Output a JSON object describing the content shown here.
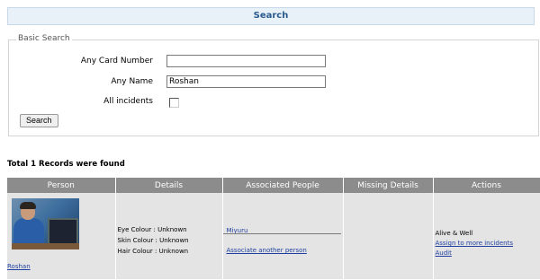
{
  "header": {
    "title": "Search"
  },
  "basic_search": {
    "legend": "Basic Search",
    "card_number": {
      "label": "Any Card Number",
      "value": ""
    },
    "name": {
      "label": "Any Name",
      "value": "Roshan"
    },
    "all_incidents": {
      "label": "All incidents",
      "checked": false
    },
    "search_button": "Search"
  },
  "results": {
    "summary": "Total 1 Records were found",
    "columns": [
      "Person",
      "Details",
      "Associated People",
      "Missing Details",
      "Actions"
    ],
    "rows": [
      {
        "person": {
          "name": "Roshan",
          "photo_icon": "person-photo"
        },
        "details": [
          "Eye Colour : Unknown",
          "Skin Colour : Unknown",
          "Hair Colour : Unknown"
        ],
        "associated": {
          "person": "Miyuru",
          "add_link": "Associate another person"
        },
        "missing_details": "",
        "actions": {
          "status": "Alive & Well",
          "assign_link": "Assign to more incidents",
          "audit_link": "Audit"
        }
      }
    ]
  }
}
